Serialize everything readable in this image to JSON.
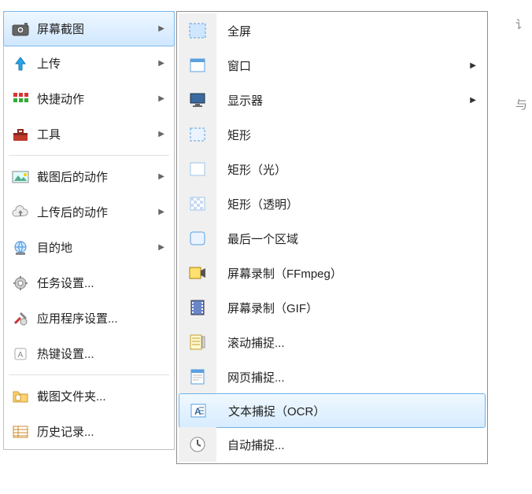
{
  "left_menu": {
    "items": [
      {
        "label": "屏幕截图",
        "icon": "camera-icon",
        "has_submenu": true,
        "selected": true
      },
      {
        "label": "上传",
        "icon": "upload-icon",
        "has_submenu": true
      },
      {
        "label": "快捷动作",
        "icon": "grid-icon",
        "has_submenu": true
      },
      {
        "label": "工具",
        "icon": "toolbox-icon",
        "has_submenu": true
      },
      {
        "sep": true
      },
      {
        "label": "截图后的动作",
        "icon": "picture-icon",
        "has_submenu": true
      },
      {
        "label": "上传后的动作",
        "icon": "cloud-upload-icon",
        "has_submenu": true
      },
      {
        "label": "目的地",
        "icon": "globe-icon",
        "has_submenu": true
      },
      {
        "label": "任务设置...",
        "icon": "gear-icon"
      },
      {
        "label": "应用程序设置...",
        "icon": "tools-gear-icon"
      },
      {
        "label": "热键设置...",
        "icon": "keyboard-key-icon"
      },
      {
        "sep": true
      },
      {
        "label": "截图文件夹...",
        "icon": "folder-icon"
      },
      {
        "label": "历史记录...",
        "icon": "table-icon"
      }
    ]
  },
  "sub_menu": {
    "items": [
      {
        "label": "全屏",
        "icon": "fullscreen-icon"
      },
      {
        "label": "窗口",
        "icon": "window-icon",
        "has_submenu": true
      },
      {
        "label": "显示器",
        "icon": "monitor-icon",
        "has_submenu": true
      },
      {
        "label": "矩形",
        "icon": "rect-icon"
      },
      {
        "label": "矩形（光）",
        "icon": "rect-light-icon"
      },
      {
        "label": "矩形（透明）",
        "icon": "rect-transparent-icon"
      },
      {
        "label": "最后一个区域",
        "icon": "last-region-icon"
      },
      {
        "label": "屏幕录制（FFmpeg）",
        "icon": "record-ffmpeg-icon"
      },
      {
        "label": "屏幕录制（GIF）",
        "icon": "film-icon"
      },
      {
        "label": "滚动捕捉...",
        "icon": "scroll-capture-icon"
      },
      {
        "label": "网页捕捉...",
        "icon": "webpage-icon"
      },
      {
        "label": "文本捕捉（OCR）",
        "icon": "ocr-icon",
        "highlight": true
      },
      {
        "label": "自动捕捉...",
        "icon": "clock-icon"
      }
    ]
  },
  "stray_text_right_top": "讠",
  "stray_text_right_mid": "与"
}
